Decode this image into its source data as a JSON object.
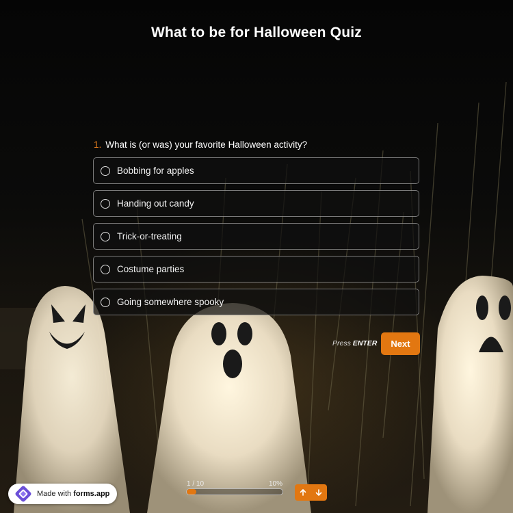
{
  "title": "What to be for Halloween Quiz",
  "question": {
    "number": "1.",
    "text": "What is (or was) your favorite Halloween activity?",
    "options": [
      "Bobbing for apples",
      "Handing out candy",
      "Trick-or-treating",
      "Costume parties",
      "Going somewhere spooky"
    ]
  },
  "hint": {
    "prefix": "Press",
    "key": "ENTER"
  },
  "next_label": "Next",
  "progress": {
    "current": "1 / 10",
    "percent_label": "10%",
    "fraction": 0.1
  },
  "badge": {
    "prefix": "Made with",
    "brand": "forms.app"
  },
  "colors": {
    "accent": "#e27711",
    "number": "#e37c1c"
  },
  "icons": {
    "nav_up": "arrow-up-icon",
    "nav_down": "arrow-down-icon",
    "logo": "forms-app-logo-icon"
  }
}
